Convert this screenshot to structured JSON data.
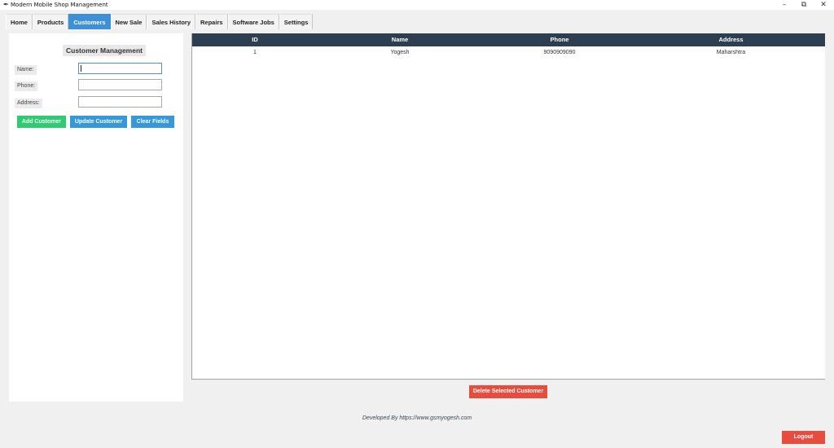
{
  "window": {
    "title": "Modern Mobile Shop Management",
    "minimize": "–",
    "maximize": "⧉",
    "close": "✕"
  },
  "tabs": [
    {
      "label": "Home",
      "active": false
    },
    {
      "label": "Products",
      "active": false
    },
    {
      "label": "Customers",
      "active": true
    },
    {
      "label": "New Sale",
      "active": false
    },
    {
      "label": "Sales History",
      "active": false
    },
    {
      "label": "Repairs",
      "active": false
    },
    {
      "label": "Software Jobs",
      "active": false
    },
    {
      "label": "Settings",
      "active": false
    }
  ],
  "form": {
    "title": "Customer Management",
    "name_label": "Name:",
    "phone_label": "Phone:",
    "address_label": "Address:",
    "name_value": "",
    "phone_value": "",
    "address_value": "",
    "add_button": "Add Customer",
    "update_button": "Update Customer",
    "clear_button": "Clear Fields"
  },
  "table": {
    "columns": [
      "ID",
      "Name",
      "Phone",
      "Address"
    ],
    "rows": [
      [
        "1",
        "Yogesh",
        "9090909090",
        "Maharshtra"
      ]
    ]
  },
  "delete_button": "Delete Selected Customer",
  "footer": "Developed By https://www.gsmyogesh.com",
  "logout_button": "Logout",
  "colors": {
    "header_bg": "#2c3e50",
    "active_tab": "#3d8fd6",
    "add_button": "#2ecc71",
    "update_button": "#3498db",
    "delete_button": "#e74c3c"
  }
}
